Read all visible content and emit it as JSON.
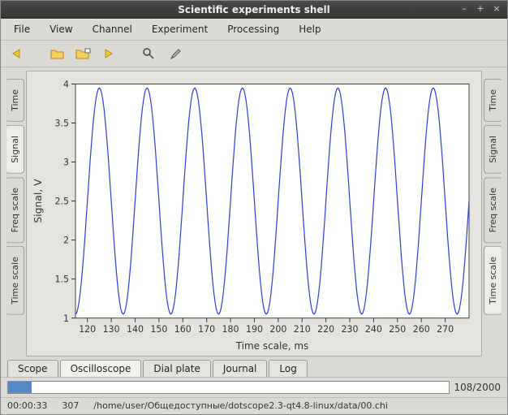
{
  "window": {
    "title": "Scientific experiments shell",
    "minimize": "–",
    "maximize": "+",
    "close": "×"
  },
  "menu": {
    "items": [
      "File",
      "View",
      "Channel",
      "Experiment",
      "Processing",
      "Help"
    ]
  },
  "toolbar": {
    "icons": [
      "back-icon",
      "open-folder-icon",
      "folder-options-icon",
      "forward-icon",
      "zoom-icon",
      "dropper-icon"
    ]
  },
  "left_tabs": [
    "Time",
    "Signal",
    "Freq scale",
    "Time scale"
  ],
  "left_active": 1,
  "right_tabs": [
    "Time",
    "Signal",
    "Freq scale",
    "Time scale"
  ],
  "right_active": 3,
  "bottom_tabs": [
    "Scope",
    "Oscilloscope",
    "Dial plate",
    "Journal",
    "Log"
  ],
  "bottom_active": 1,
  "progress": {
    "label": "108/2000",
    "percent": 5.4
  },
  "status": {
    "time": "00:00:33",
    "frame": "307",
    "path": "/home/user/Общедоступные/dotscope2.3-qt4.8-linux/data/00.chi"
  },
  "chart_data": {
    "type": "line",
    "title": "",
    "xlabel": "Time scale, ms",
    "ylabel": "Signal, V",
    "xlim": [
      115,
      280
    ],
    "ylim": [
      1,
      4
    ],
    "xticks": [
      120,
      130,
      140,
      150,
      160,
      170,
      180,
      190,
      200,
      210,
      220,
      230,
      240,
      250,
      260,
      270
    ],
    "yticks": [
      1,
      1.5,
      2,
      2.5,
      3,
      3.5,
      4
    ],
    "series": [
      {
        "name": "signal",
        "amplitude": 1.45,
        "offset": 2.5,
        "period_ms": 20,
        "phase_ms": 120,
        "sample_step": 0.5
      }
    ]
  }
}
